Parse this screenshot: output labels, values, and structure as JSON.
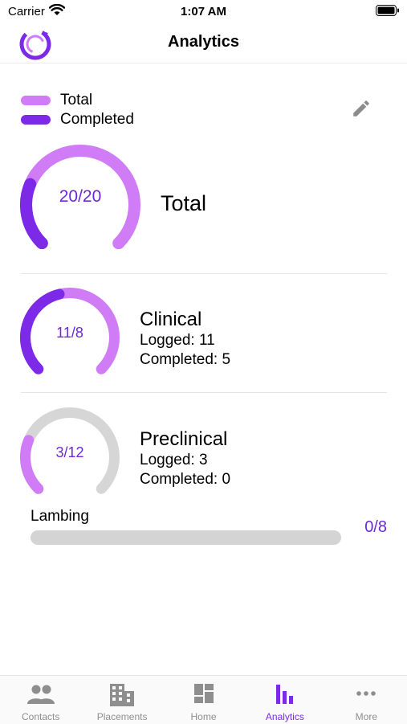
{
  "status": {
    "carrier": "Carrier",
    "time": "1:07 AM"
  },
  "nav": {
    "title": "Analytics",
    "logo_icon": "refresh-ring-logo"
  },
  "colors": {
    "total": "#d17cf7",
    "completed": "#7c2ae8",
    "empty": "#d6d6d6",
    "accent_text": "#6d28d9"
  },
  "legend": [
    {
      "label": "Total",
      "color": "#d17cf7"
    },
    {
      "label": "Completed",
      "color": "#7c2ae8"
    }
  ],
  "edit_icon": "pencil-icon",
  "total": {
    "gauge_label": "20/20",
    "title": "Total",
    "completed_fraction": 0.25,
    "total_fraction": 1.0
  },
  "categories": [
    {
      "title": "Clinical",
      "gauge_label": "11/8",
      "logged_text": "Logged: 11",
      "completed_text": "Completed: 5",
      "completed_fraction": 0.45,
      "total_fraction": 1.0
    },
    {
      "title": "Preclinical",
      "gauge_label": "3/12",
      "logged_text": "Logged: 3",
      "completed_text": "Completed: 0",
      "completed_fraction": 0.0,
      "total_fraction": 0.25
    }
  ],
  "lambing": {
    "label": "Lambing",
    "value": "0/8",
    "progress": 0.0
  },
  "tabs": [
    {
      "label": "Contacts",
      "icon": "people-icon",
      "active": false
    },
    {
      "label": "Placements",
      "icon": "building-icon",
      "active": false
    },
    {
      "label": "Home",
      "icon": "dashboard-icon",
      "active": false
    },
    {
      "label": "Analytics",
      "icon": "bar-chart-icon",
      "active": true
    },
    {
      "label": "More",
      "icon": "more-dots-icon",
      "active": false
    }
  ]
}
